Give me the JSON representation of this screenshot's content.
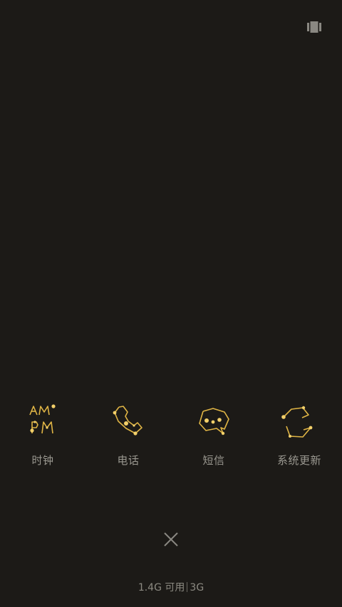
{
  "header": {
    "recents_icon": "card-stack-icon"
  },
  "apps": [
    {
      "label": "时钟",
      "icon": "clock-ampm-icon"
    },
    {
      "label": "电话",
      "icon": "phone-icon"
    },
    {
      "label": "短信",
      "icon": "message-icon"
    },
    {
      "label": "系统更新",
      "icon": "system-update-icon"
    }
  ],
  "close": {
    "icon": "close-icon"
  },
  "memory": {
    "available": "1.4G 可用",
    "total": "3G"
  },
  "colors": {
    "background": "#1c1a17",
    "icon_gold": "#e0b545",
    "label": "#9a9890"
  }
}
